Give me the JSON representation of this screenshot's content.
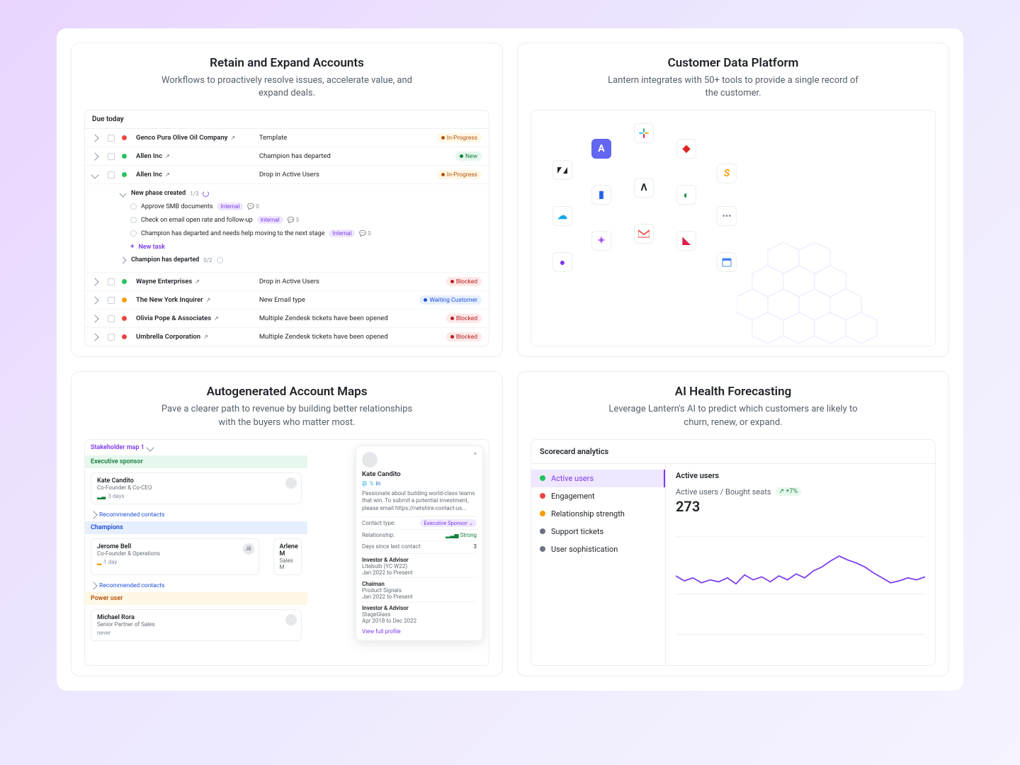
{
  "cards": {
    "retain": {
      "title": "Retain and Expand Accounts",
      "sub": "Workflows to proactively resolve issues, accelerate value, and expand deals.",
      "section": "Due today",
      "rows": [
        {
          "dot": "d-red",
          "name": "Genco Pura Olive Oil Company",
          "desc": "Template",
          "status": "In-Progress",
          "scls": "b-prog"
        },
        {
          "dot": "d-grn",
          "name": "Allen Inc",
          "desc": "Champion has departed",
          "status": "New",
          "scls": "b-new"
        },
        {
          "dot": "d-grn",
          "name": "Allen Inc",
          "desc": "Drop in Active Users",
          "status": "In-Progress",
          "scls": "b-prog",
          "expanded": true
        },
        {
          "dot": "d-grn",
          "name": "Wayne Enterprises",
          "desc": "Drop in Active Users",
          "status": "Blocked",
          "scls": "b-block"
        },
        {
          "dot": "d-yel",
          "name": "The New York Inquirer",
          "desc": "New Email type",
          "status": "Waiting Customer",
          "scls": "b-wait"
        },
        {
          "dot": "d-red",
          "name": "Olivia Pope & Associates",
          "desc": "Multiple Zendesk tickets have been opened",
          "status": "Blocked",
          "scls": "b-block"
        },
        {
          "dot": "d-red",
          "name": "Umbrella Corporation",
          "desc": "Multiple Zendesk tickets have been opened",
          "status": "Blocked",
          "scls": "b-block"
        }
      ],
      "phase": {
        "title": "New phase created",
        "count": "1/3",
        "tasks": [
          {
            "t": "Approve SMB documents",
            "int": "Internal",
            "c": "0"
          },
          {
            "t": "Check on email open rate and follow-up",
            "int": "Internal",
            "c": "3"
          },
          {
            "t": "Champion has departed and needs help moving to the next stage",
            "int": "Internal",
            "c": "0"
          }
        ],
        "new": "New task",
        "champ": {
          "t": "Champion has departed",
          "c": "0/2"
        }
      }
    },
    "cdp": {
      "title": "Customer Data Platform",
      "sub": "Lantern integrates with 50+ tools to provide a single record of the customer."
    },
    "amaps": {
      "title": "Autogenerated Account Maps",
      "sub": "Pave a clearer path to revenue by building better relationships with the buyers who matter most.",
      "sel": "Stakeholder map 1",
      "cats": {
        "exec": "Executive sponsor",
        "champ": "Champions",
        "power": "Power user"
      },
      "rec": "Recommended contacts",
      "p1": {
        "n": "Kate Candito",
        "r": "Co-Founder & Co-CEO",
        "d": "3 days"
      },
      "p2": {
        "n": "Jerome Bell",
        "r": "Co-Founder & Operations",
        "d": "1 day",
        "ini": "JB"
      },
      "p3": {
        "n": "Arlene M",
        "r": "Sales M"
      },
      "p4": {
        "n": "Michael Rora",
        "r": "Senior Partner of Sales",
        "d": "never"
      },
      "pop": {
        "name": "Kate Candito",
        "bio": "Passionate about building world-class teams that win. To submit a potential investment, please email https://netshire-contact-us...",
        "ct_lbl": "Contact type:",
        "ct_val": "Executive Sponsor",
        "rel_lbl": "Relationship:",
        "rel_val": "Strong",
        "days_lbl": "Days since last contact:",
        "days_val": "3",
        "roles": [
          {
            "t": "Investor & Advisor",
            "c": "Litebulb (YC W22)",
            "d": "Jan 2022 to Present"
          },
          {
            "t": "Chaiman",
            "c": "Product Signals",
            "d": "Jan 2022 to Present"
          },
          {
            "t": "Investor & Advisor",
            "c": "StageGlass",
            "d": "Apr 2018 to Dec 2022"
          }
        ],
        "view": "View full profile"
      }
    },
    "ai": {
      "title": "AI Health Forecasting",
      "sub": "Leverage Lantern's AI to predict which customers are likely to churn, renew, or expand.",
      "scorecard": "Scorecard analytics",
      "metrics": [
        {
          "n": "Active users",
          "c": "#22c55e"
        },
        {
          "n": "Engagement",
          "c": "#ef4444"
        },
        {
          "n": "Relationship strength",
          "c": "#f59e0b"
        },
        {
          "n": "Support tickets",
          "c": "#6b7280"
        },
        {
          "n": "User sophistication",
          "c": "#6b7280"
        }
      ],
      "main": {
        "title": "Active users",
        "sub": "Active users / Bought seats",
        "pct": "+7%",
        "val": "273"
      }
    }
  },
  "chart_data": {
    "type": "line",
    "title": "Active users / Bought seats",
    "ylabel": "",
    "xlabel": "",
    "values": [
      260,
      255,
      258,
      253,
      256,
      254,
      258,
      252,
      261,
      256,
      259,
      254,
      260,
      256,
      262,
      258,
      265,
      269,
      275,
      280,
      276,
      273,
      269,
      263,
      258,
      253,
      255,
      258,
      256,
      259
    ],
    "ylim": [
      200,
      300
    ]
  }
}
